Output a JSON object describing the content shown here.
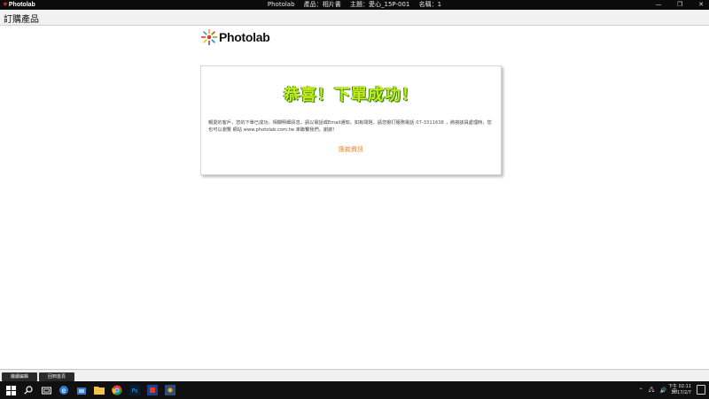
{
  "window": {
    "app_name": "Photolab",
    "title_main": "Photolab",
    "title_product": "產品：相片書",
    "title_theme": "主題：愛心_15P-001",
    "title_name": "名稱：1"
  },
  "header": {
    "page_title": "訂購產品"
  },
  "logo": {
    "text": "Photolab"
  },
  "card": {
    "success_title": "恭喜！下單成功！",
    "message_part1": "親愛的客戶，您的下單已成功，相關明細訊息，請以電話或Email通知，如有問題，請您撥打服務電話",
    "phone": "07-3311638",
    "message_part2": "，將詢該員處理時，您也可以瀏覽 網站 www.photolab.com.tw 來聯繫我們，謝謝！",
    "payment_link": "匯款資訊"
  },
  "bottom_buttons": {
    "btn1": "繼續編輯",
    "btn2": "回到首頁"
  },
  "taskbar": {
    "clock_time": "下午 02:11",
    "clock_date": "2017/2/7",
    "tray_lang": "中"
  }
}
